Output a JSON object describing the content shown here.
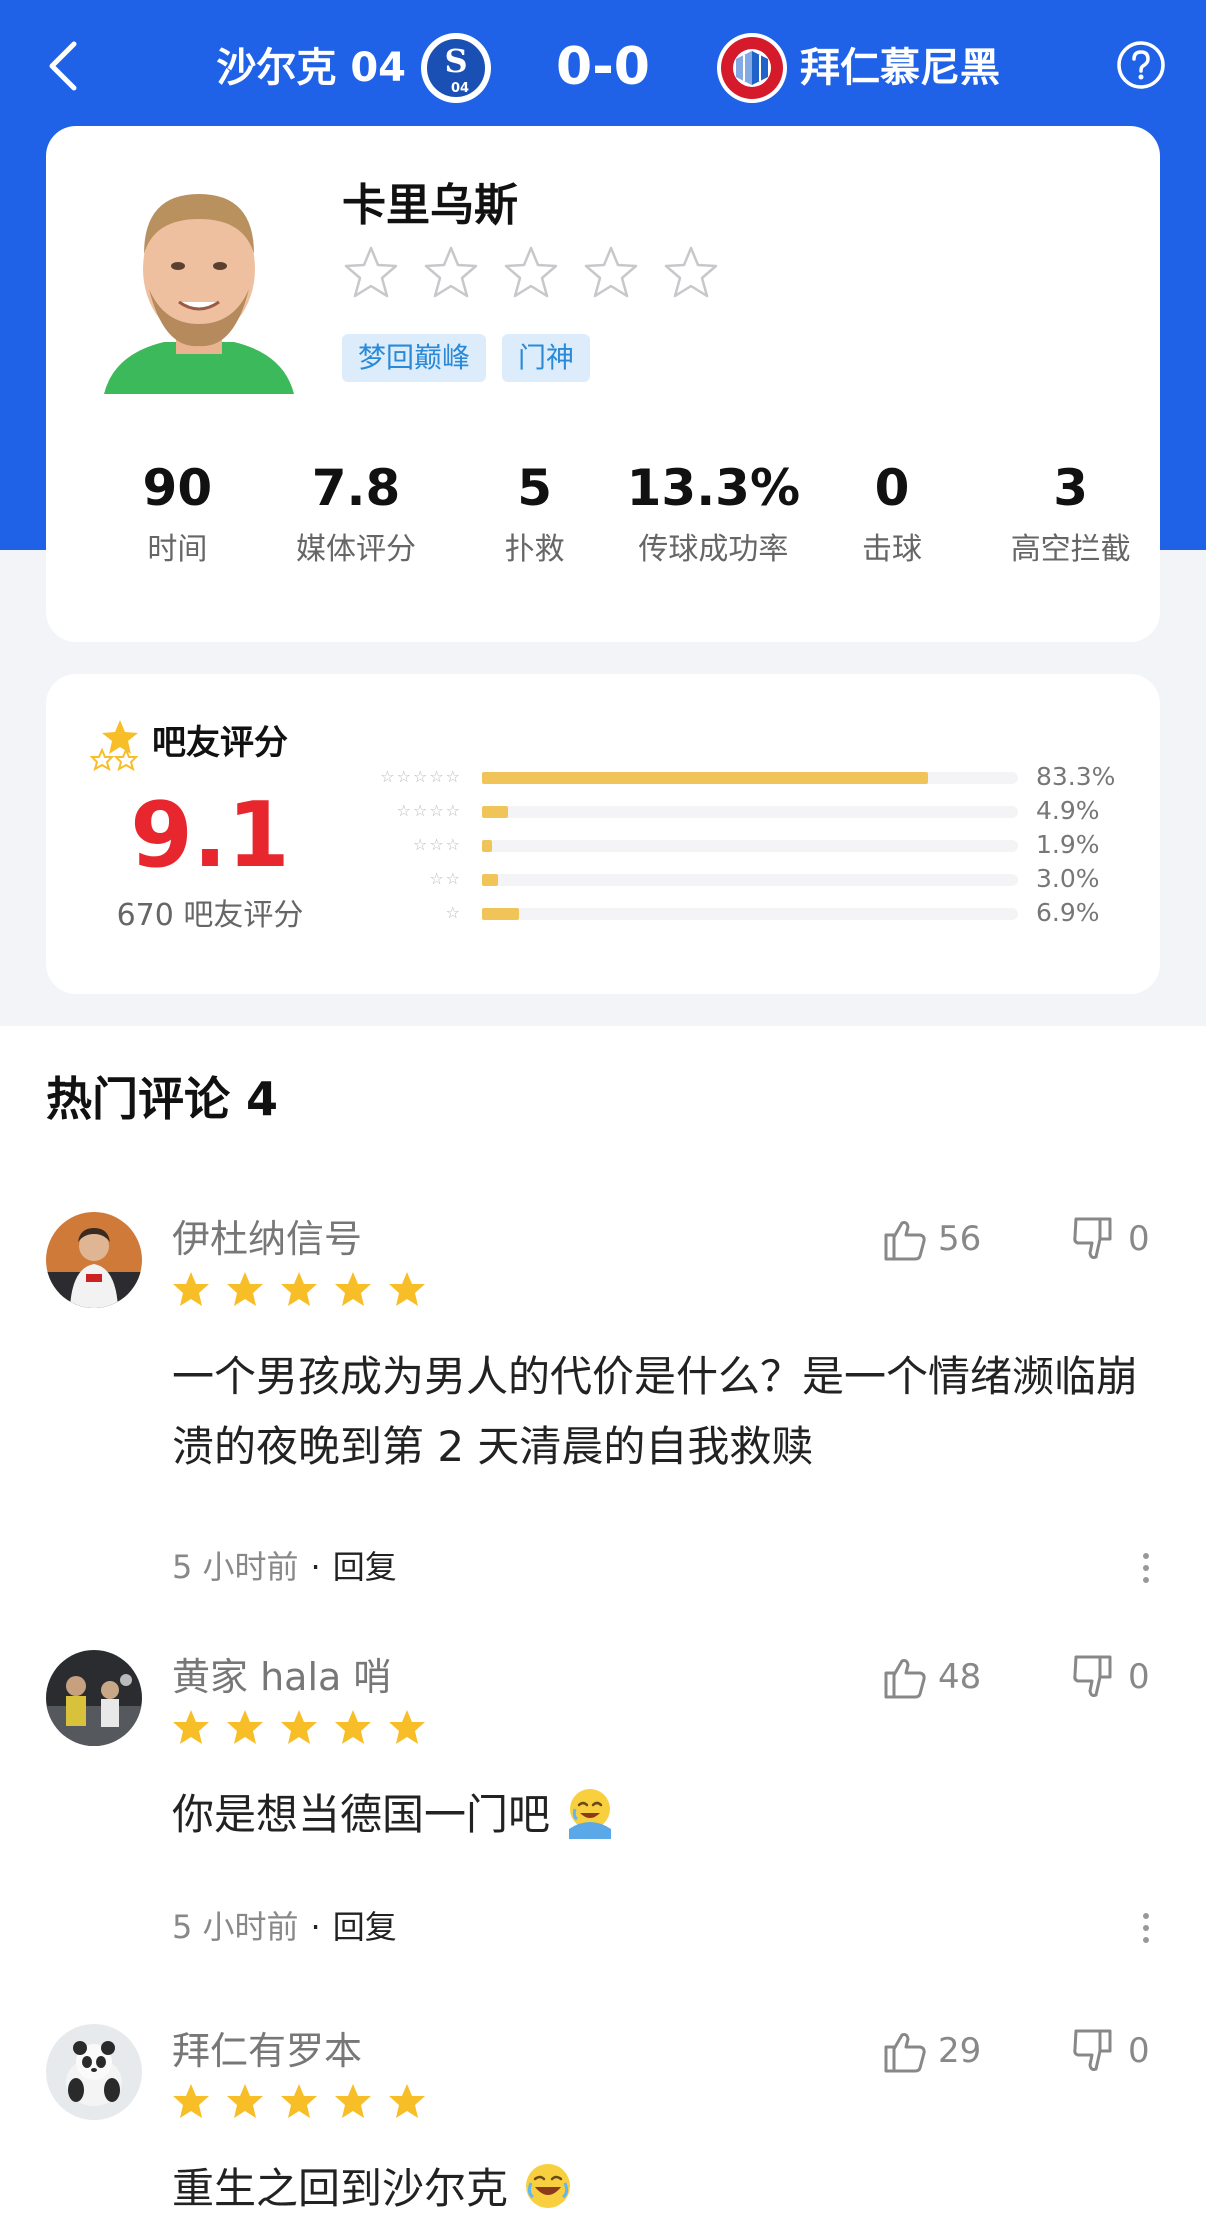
{
  "header": {
    "home_team": "沙尔克 04",
    "score": "0-0",
    "away_team": "拜仁慕尼黑"
  },
  "player": {
    "name": "卡里乌斯",
    "tags": [
      "梦回巅峰",
      "门神"
    ],
    "stats": [
      {
        "value": "90",
        "label": "时间"
      },
      {
        "value": "7.8",
        "label": "媒体评分"
      },
      {
        "value": "5",
        "label": "扑救"
      },
      {
        "value": "13.3%",
        "label": "传球成功率"
      },
      {
        "value": "0",
        "label": "击球"
      },
      {
        "value": "3",
        "label": "高空拦截"
      }
    ]
  },
  "fan_rating": {
    "title": "吧友评分",
    "score": "9.1",
    "count": "670 吧友评分",
    "distribution": [
      {
        "stars": "☆☆☆☆☆",
        "percent": 83.3,
        "label": "83.3%"
      },
      {
        "stars": "☆☆☆☆",
        "percent": 4.9,
        "label": "4.9%"
      },
      {
        "stars": "☆☆☆",
        "percent": 1.9,
        "label": "1.9%"
      },
      {
        "stars": "☆☆",
        "percent": 3.0,
        "label": "3.0%"
      },
      {
        "stars": "☆",
        "percent": 6.9,
        "label": "6.9%"
      }
    ]
  },
  "comments": {
    "title": "热门评论 4",
    "items": [
      {
        "user": "伊杜纳信号",
        "rating": 5,
        "likes": "56",
        "dislikes": "0",
        "text": "一个男孩成为男人的代价是什么？是一个情绪濒临崩溃的夜晚到第 2 天清晨的自我救赎",
        "time": "5 小时前",
        "reply": "回复"
      },
      {
        "user": "黄家 hala 哨",
        "rating": 5,
        "likes": "48",
        "dislikes": "0",
        "text": "你是想当德国一门吧",
        "time": "5 小时前",
        "reply": "回复"
      },
      {
        "user": "拜仁有罗本",
        "rating": 5,
        "likes": "29",
        "dislikes": "0",
        "text": "重生之回到沙尔克",
        "time": "",
        "reply": ""
      }
    ]
  },
  "colors": {
    "header_blue": "#1f62e8",
    "score_red": "#e8262d",
    "star_yellow": "#f7be28",
    "bar_yellow": "#f1c45a",
    "tag_bg": "#dcecfb",
    "tag_text": "#2a8ad8"
  },
  "icons": [
    "back-icon",
    "help-icon",
    "schalke-logo",
    "bayern-logo",
    "star-icon",
    "thumbs-up-icon",
    "thumbs-down-icon",
    "more-icon",
    "emoji-icon"
  ]
}
